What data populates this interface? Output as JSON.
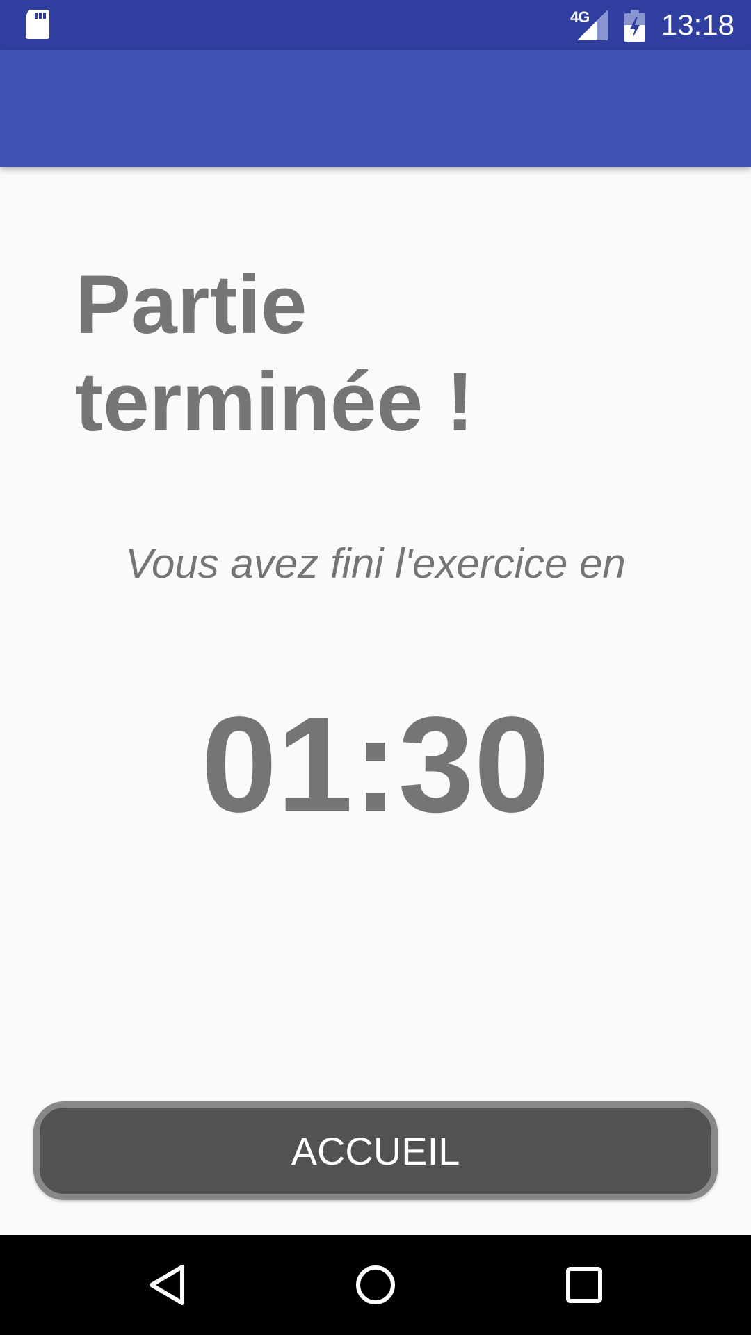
{
  "status_bar": {
    "network_label": "4G",
    "time": "13:18",
    "icons": [
      "sd-card-icon",
      "signal-icon",
      "battery-charging-icon"
    ],
    "background_color": "#303f9f"
  },
  "app_bar": {
    "background_color": "#3f51b5"
  },
  "main": {
    "title": "Partie terminée !",
    "subtitle": "Vous avez fini l'exercice en",
    "elapsed_time": "01:30",
    "text_color": "#757575"
  },
  "home_button": {
    "label": "ACCUEIL",
    "background_color": "#525252",
    "border_color": "#888888"
  },
  "nav_bar": {
    "icons": [
      "back-icon",
      "home-icon",
      "recents-icon"
    ]
  }
}
